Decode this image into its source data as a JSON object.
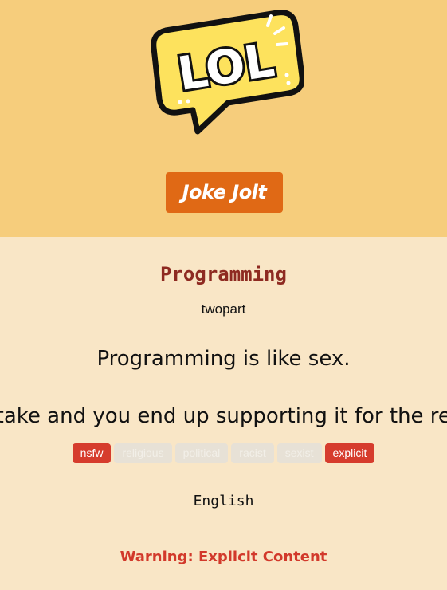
{
  "header": {
    "logo_text": "LOL",
    "brand_button_label": "Joke Jolt"
  },
  "joke": {
    "category": "Programming",
    "type": "twopart",
    "setup": "Programming is like sex.",
    "delivery": "Make one mistake and you end up supporting it for the rest of your life.",
    "language": "English",
    "warning": "Warning: Explicit Content"
  },
  "flags": [
    {
      "label": "nsfw",
      "active": true
    },
    {
      "label": "religious",
      "active": false
    },
    {
      "label": "political",
      "active": false
    },
    {
      "label": "racist",
      "active": false
    },
    {
      "label": "sexist",
      "active": false
    },
    {
      "label": "explicit",
      "active": true
    }
  ],
  "colors": {
    "header_bg": "#f6cd7c",
    "page_bg": "#f9e6c6",
    "brand_button": "#e06915",
    "category_text": "#8e2a21",
    "flag_active": "#d63c2d",
    "flag_inactive": "#e7e1d6",
    "warning_text": "#d2392b"
  }
}
